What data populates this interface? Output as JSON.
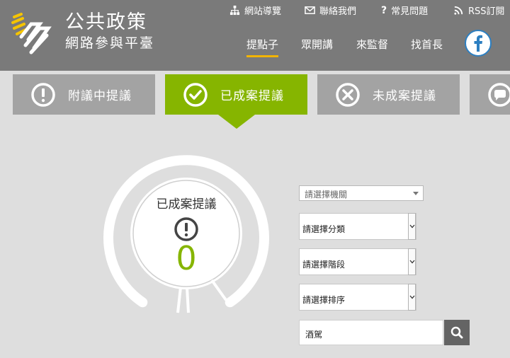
{
  "brand": {
    "title": "公共政策",
    "subtitle": "網路參與平臺"
  },
  "utility_links": [
    {
      "label": "網站導覽",
      "icon": "sitemap-icon"
    },
    {
      "label": "聯絡我們",
      "icon": "envelope-icon"
    },
    {
      "label": "常見問題",
      "icon": "question-icon"
    },
    {
      "label": "RSS訂閱",
      "icon": "rss-icon"
    }
  ],
  "main_nav": [
    {
      "label": "提點子",
      "active": true
    },
    {
      "label": "眾開講",
      "active": false
    },
    {
      "label": "來監督",
      "active": false
    },
    {
      "label": "找首長",
      "active": false
    }
  ],
  "social": {
    "icon": "facebook-icon"
  },
  "tabs": [
    {
      "label": "附議中提議",
      "icon": "exclamation-circle-icon",
      "active": false
    },
    {
      "label": "已成案提議",
      "icon": "check-circle-icon",
      "active": true
    },
    {
      "label": "未成案提議",
      "icon": "x-circle-icon",
      "active": false
    },
    {
      "label": "",
      "icon": "chat-bubble-icon",
      "active": false
    }
  ],
  "gauge": {
    "title": "已成案提議",
    "count": "0",
    "icon": "exclamation-circle-icon"
  },
  "filters": {
    "agency": "請選擇機關",
    "category": "請選擇分類",
    "stage": "請選擇階段",
    "sort": "請選擇排序"
  },
  "search": {
    "value": "酒駕",
    "icon": "search-icon"
  },
  "colors": {
    "header": "#7a7a7a",
    "active_tab": "#86b500",
    "inactive_tab": "#a3a3a3",
    "nav_underline": "#f2b400",
    "background": "#dedede",
    "facebook": "#2d7fc1"
  }
}
